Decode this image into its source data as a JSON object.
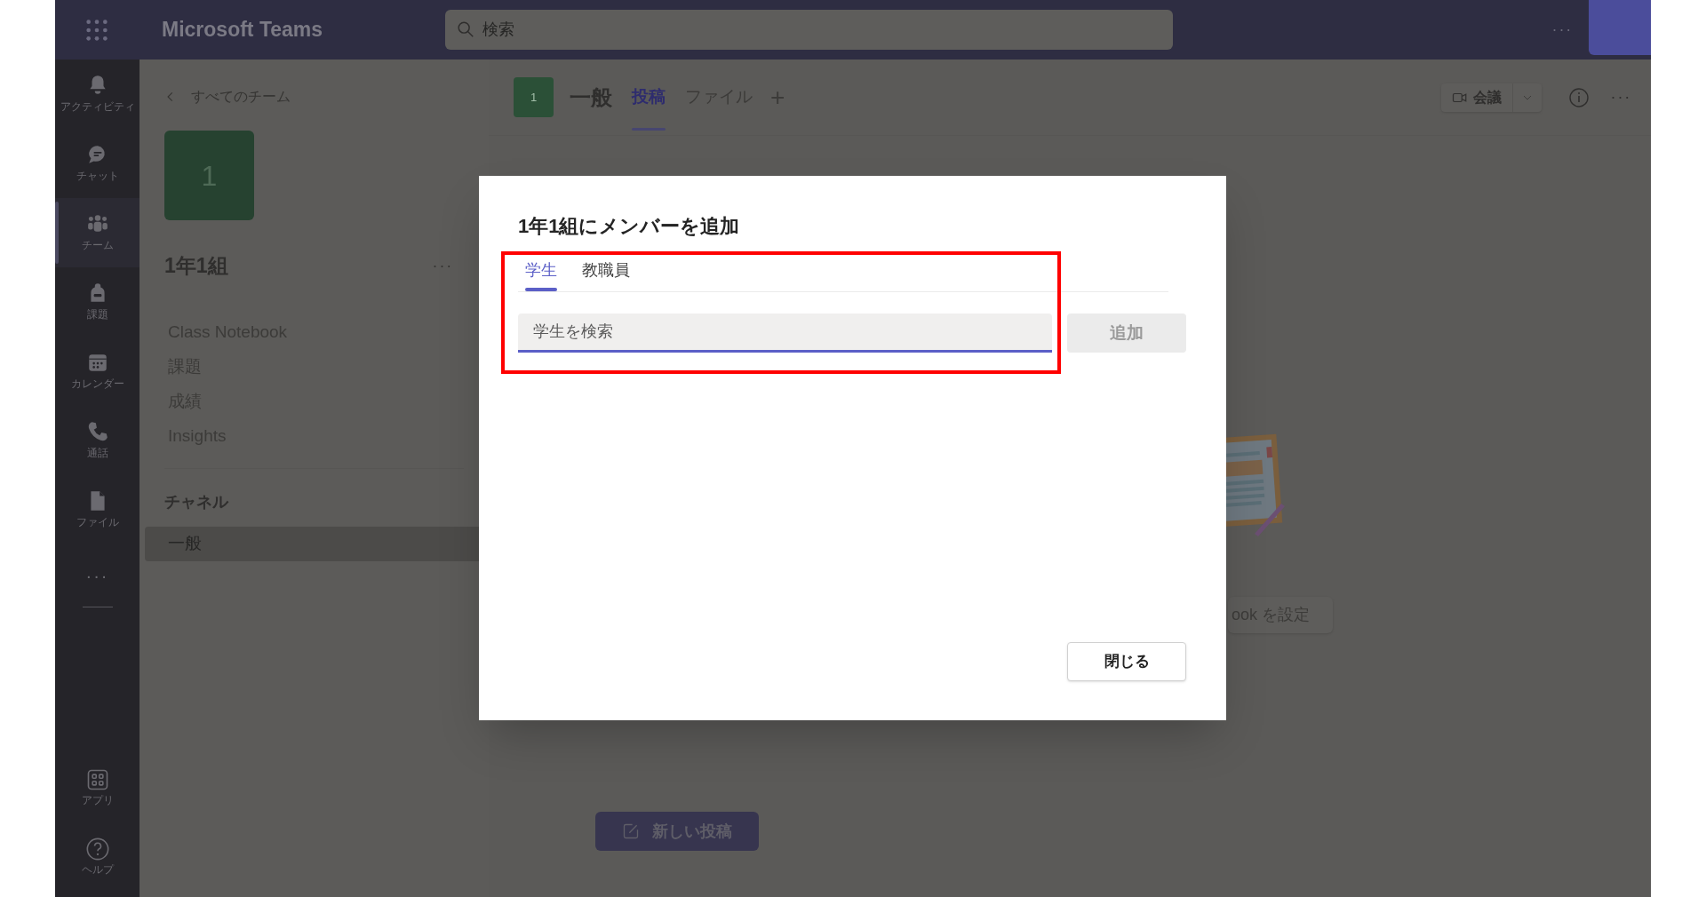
{
  "app_bar": {
    "title": "Microsoft Teams",
    "search": {
      "placeholder": "検索"
    },
    "more": "···"
  },
  "rail": {
    "items": [
      {
        "label": "アクティビティ",
        "selected": false
      },
      {
        "label": "チャット",
        "selected": false
      },
      {
        "label": "チーム",
        "selected": true
      },
      {
        "label": "課題",
        "selected": false
      },
      {
        "label": "カレンダー",
        "selected": false
      },
      {
        "label": "通話",
        "selected": false
      },
      {
        "label": "ファイル",
        "selected": false
      }
    ],
    "more": "···",
    "bottom": [
      {
        "label": "アプリ"
      },
      {
        "label": "ヘルプ"
      }
    ]
  },
  "sidebar": {
    "back": "すべてのチーム",
    "team_avatar": "1",
    "team_name": "1年1組",
    "team_more": "···",
    "links": [
      "Class Notebook",
      "課題",
      "成績",
      "Insights"
    ],
    "channels_heading": "チャネル",
    "channels": [
      {
        "name": "一般",
        "selected": true
      }
    ]
  },
  "channel_header": {
    "avatar": "1",
    "name": "一般",
    "tabs": [
      {
        "label": "投稿",
        "selected": true
      },
      {
        "label": "ファイル",
        "selected": false
      }
    ],
    "add": "+",
    "meeting": "会議",
    "more": "···"
  },
  "background": {
    "setup_button": "ook を設定",
    "new_post": "新しい投稿"
  },
  "dialog": {
    "title": "1年1組にメンバーを追加",
    "tabs": [
      {
        "label": "学生",
        "selected": true
      },
      {
        "label": "教職員",
        "selected": false
      }
    ],
    "search": {
      "placeholder": "学生を検索"
    },
    "add_button": {
      "label": "追加",
      "disabled": true
    },
    "close_button": "閉じる",
    "highlight": true
  }
}
